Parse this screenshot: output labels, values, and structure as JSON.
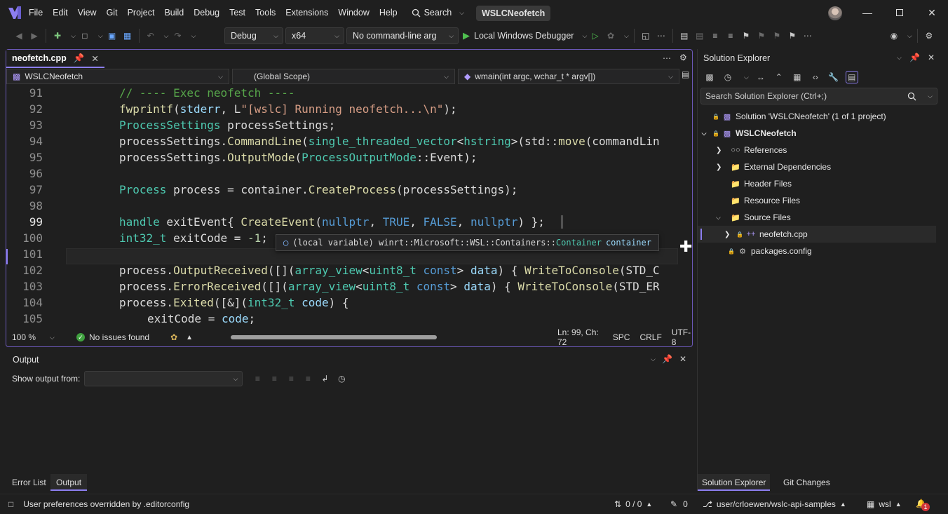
{
  "menu": [
    "File",
    "Edit",
    "View",
    "Git",
    "Project",
    "Build",
    "Debug",
    "Test",
    "Tools",
    "Extensions",
    "Window",
    "Help"
  ],
  "search_label": "Search",
  "window_title": "WSLCNeofetch",
  "toolbar": {
    "config": "Debug",
    "platform": "x64",
    "args": "No command-line arg",
    "debugger": "Local Windows Debugger"
  },
  "editor": {
    "tab_name": "neofetch.cpp",
    "nav_project": "WSLCNeofetch",
    "nav_scope": "(Global Scope)",
    "nav_function": "wmain(int argc, wchar_t * argv[])",
    "line_numbers": [
      "91",
      "92",
      "93",
      "94",
      "95",
      "96",
      "97",
      "98",
      "99",
      "100",
      "101",
      "102",
      "103",
      "104",
      "105"
    ],
    "tooltip_prefix": "(local variable) winrt::Microsoft::WSL::Containers::",
    "tooltip_type": "Container",
    "tooltip_name": "container",
    "zoom": "100 %",
    "issues": "No issues found",
    "position": "Ln: 99, Ch: 72",
    "indent": "SPC",
    "line_ending": "CRLF",
    "encoding": "UTF-8"
  },
  "output": {
    "title": "Output",
    "show_from_label": "Show output from:",
    "show_from_value": ""
  },
  "bottom_tabs": [
    "Error List",
    "Output"
  ],
  "solution": {
    "title": "Solution Explorer",
    "search_placeholder": "Search Solution Explorer (Ctrl+;)",
    "items": [
      "Solution 'WSLCNeofetch' (1 of 1 project)",
      "WSLCNeofetch",
      "References",
      "External Dependencies",
      "Header Files",
      "Resource Files",
      "Source Files",
      "neofetch.cpp",
      "packages.config"
    ],
    "tabs": [
      "Solution Explorer",
      "Git Changes"
    ]
  },
  "status": {
    "message": "User preferences overridden by .editorconfig",
    "sync": "0 / 0",
    "edits": "0",
    "branch": "user/crloewen/wslc-api-samples",
    "repo": "wsl",
    "notifications": "1"
  },
  "colors": {
    "accent": "#8c7ef0",
    "background": "#1f1f1f",
    "comment": "#57a64a",
    "keyword": "#569cd6",
    "type": "#4ec9b0",
    "string": "#d69d85",
    "function": "#dcdcaa"
  }
}
